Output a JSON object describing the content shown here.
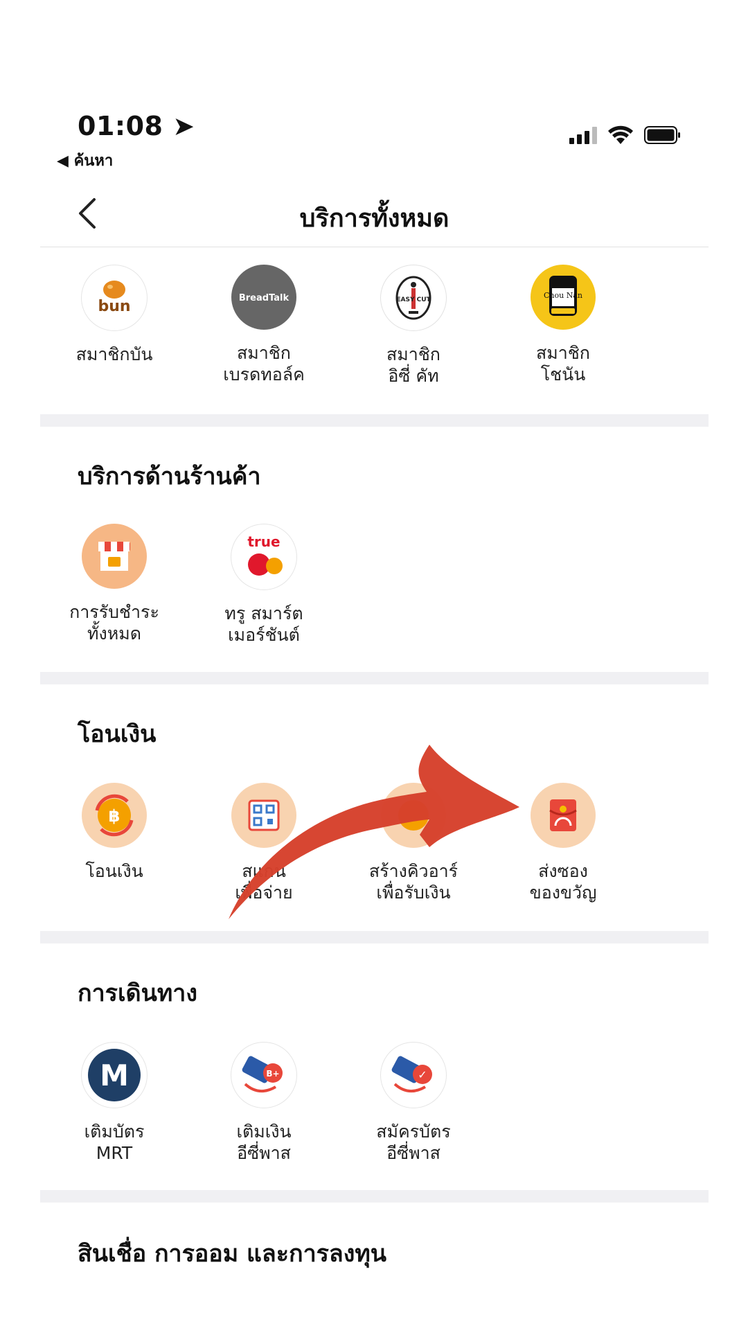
{
  "status": {
    "time": "01:08",
    "back_app": "◀ ค้นหา"
  },
  "nav": {
    "title": "บริการทั้งหมด"
  },
  "members": [
    {
      "line1": "สมาชิกบัน",
      "line2": "",
      "icon": "bun-logo-icon",
      "icon_text": "bun",
      "color": "#f0a838"
    },
    {
      "line1": "สมาชิก",
      "line2": "เบรดทอล์ค",
      "icon": "breadtalk-logo-icon",
      "icon_text": "BreadTalk",
      "color": "#666666"
    },
    {
      "line1": "สมาชิก",
      "line2": "อิซี่ คัท",
      "icon": "easycut-logo-icon",
      "icon_text": "EASY CUT",
      "color": "#ffffff"
    },
    {
      "line1": "สมาชิก",
      "line2": "โชนัน",
      "icon": "chounan-logo-icon",
      "icon_text": "Chou Nan",
      "color": "#f5c518"
    }
  ],
  "merchant": {
    "title": "บริการด้านร้านค้า",
    "items": [
      {
        "line1": "การรับชำระ",
        "line2": "ทั้งหมด",
        "icon": "shop-icon",
        "icon_text": ""
      },
      {
        "line1": "ทรู สมาร์ต",
        "line2": "เมอร์ชันต์",
        "icon": "true-smart-merchant-icon",
        "icon_text": "true"
      }
    ]
  },
  "transfer": {
    "title": "โอนเงิน",
    "items": [
      {
        "line1": "โอนเงิน",
        "line2": "",
        "icon": "baht-transfer-icon",
        "icon_text": "฿"
      },
      {
        "line1": "สแกน",
        "line2": "เพื่อจ่าย",
        "icon": "qr-scan-icon",
        "icon_text": ""
      },
      {
        "line1": "สร้างคิวอาร์",
        "line2": "เพื่อรับเงิน",
        "icon": "qr-receive-icon",
        "icon_text": ""
      },
      {
        "line1": "ส่งซอง",
        "line2": "ของขวัญ",
        "icon": "gift-envelope-icon",
        "icon_text": ""
      }
    ]
  },
  "travel": {
    "title": "การเดินทาง",
    "items": [
      {
        "line1": "เติมบัตร",
        "line2": "MRT",
        "icon": "mrt-icon",
        "icon_text": "M"
      },
      {
        "line1": "เติมเงิน",
        "line2": "อีซี่พาส",
        "icon": "easypass-topup-icon",
        "icon_text": "B+"
      },
      {
        "line1": "สมัครบัตร",
        "line2": "อีซี่พาส",
        "icon": "easypass-register-icon",
        "icon_text": "✓"
      }
    ]
  },
  "loans": {
    "title": "สินเชื่อ การออม และการลงทุน"
  }
}
